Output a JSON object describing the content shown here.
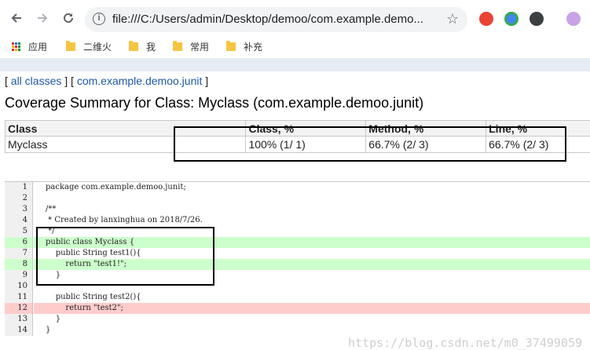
{
  "browser": {
    "url": "file:///C:/Users/admin/Desktop/demoo/com.example.demo...",
    "bookmarks": [
      {
        "label": "应用",
        "icon": "apps-grid-icon"
      },
      {
        "label": "二维火",
        "icon": "folder-icon"
      },
      {
        "label": "我",
        "icon": "folder-icon"
      },
      {
        "label": "常用",
        "icon": "folder-icon"
      },
      {
        "label": "补充",
        "icon": "folder-icon"
      }
    ]
  },
  "breadcrumb": {
    "open1": "[ ",
    "all_classes": "all classes",
    "mid": " ] [ ",
    "package": "com.example.demoo.junit",
    "close": " ]"
  },
  "summary": {
    "title": "Coverage Summary for Class: Myclass (com.example.demoo.junit)",
    "columns": [
      "Class",
      "Class, %",
      "Method, %",
      "Line, %"
    ],
    "rows": [
      [
        "Myclass",
        "100% (1/ 1)",
        "66.7% (2/ 3)",
        "66.7% (2/ 3)"
      ]
    ]
  },
  "source": {
    "lines": [
      {
        "n": "1",
        "text": "package com.example.demoo.junit;",
        "status": "none"
      },
      {
        "n": "2",
        "text": "",
        "status": "none"
      },
      {
        "n": "3",
        "text": "/**",
        "status": "none"
      },
      {
        "n": "4",
        "text": " * Created by lanxinghua on 2018/7/26.",
        "status": "none"
      },
      {
        "n": "5",
        "text": " */",
        "status": "none"
      },
      {
        "n": "6",
        "text": "public class Myclass {",
        "status": "covered"
      },
      {
        "n": "7",
        "text": "    public String test1(){",
        "status": "none"
      },
      {
        "n": "8",
        "text": "        return \"test1!\";",
        "status": "covered"
      },
      {
        "n": "9",
        "text": "    }",
        "status": "none"
      },
      {
        "n": "10",
        "text": "",
        "status": "none"
      },
      {
        "n": "11",
        "text": "    public String test2(){",
        "status": "none"
      },
      {
        "n": "12",
        "text": "        return \"test2\";",
        "status": "uncovered"
      },
      {
        "n": "13",
        "text": "    }",
        "status": "none"
      },
      {
        "n": "14",
        "text": "}",
        "status": "none"
      }
    ]
  },
  "colors": {
    "covered": "#ccffcc",
    "uncovered": "#ffcccc",
    "link": "#1c59a6"
  },
  "watermark": "https://blog.csdn.net/m0_37499059"
}
